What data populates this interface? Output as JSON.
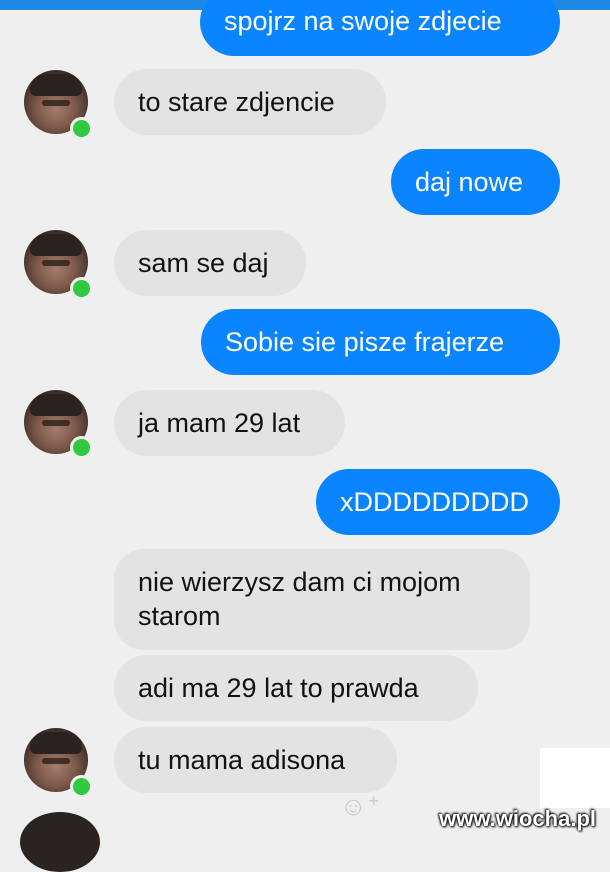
{
  "messages": [
    {
      "direction": "outgoing",
      "text": "spojrz na swoje zdjecie"
    },
    {
      "direction": "incoming",
      "text": "to stare zdjencie"
    },
    {
      "direction": "outgoing",
      "text": "daj nowe"
    },
    {
      "direction": "incoming",
      "text": "sam se daj"
    },
    {
      "direction": "outgoing",
      "text": "Sobie sie pisze frajerze"
    },
    {
      "direction": "incoming",
      "text": "ja mam 29 lat"
    },
    {
      "direction": "outgoing",
      "text": "xDDDDDDDDD"
    },
    {
      "direction": "incoming",
      "text": "nie wierzysz dam ci mojom starom"
    },
    {
      "direction": "incoming",
      "text": "adi ma 29 lat to prawda"
    },
    {
      "direction": "incoming",
      "text": "tu mama adisona"
    }
  ],
  "watermark": "www.wiocha.pl",
  "colors": {
    "outgoing_bubble": "#0a84ff",
    "incoming_bubble": "#e3e3e3",
    "online_dot": "#31c93f",
    "background": "#efefef"
  },
  "icons": {
    "emoji_button": "smiley-plus-icon",
    "presence": "online-dot-icon"
  }
}
